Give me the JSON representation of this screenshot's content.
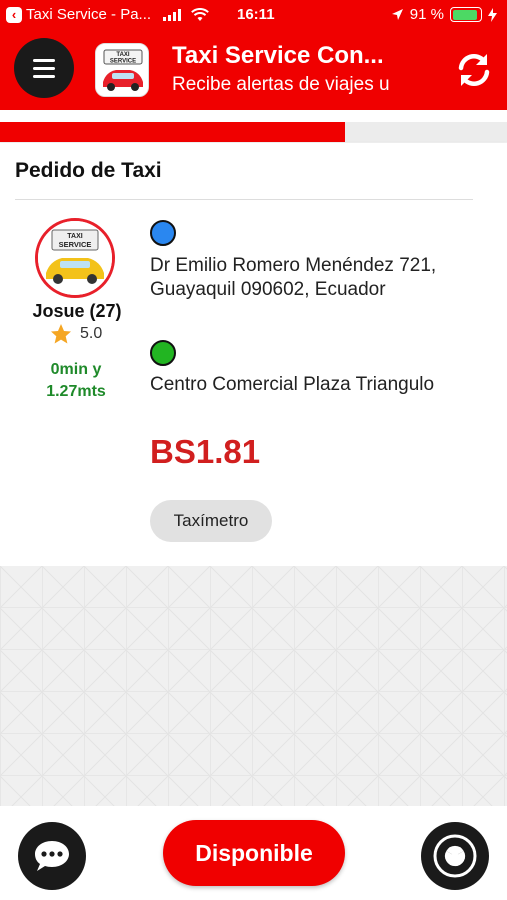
{
  "status_bar": {
    "back_app": "Taxi Service - Pa...",
    "time": "16:11",
    "battery": "91 %",
    "battery_level": 0.91
  },
  "header": {
    "title": "Taxi Service Con...",
    "subtitle": "Recibe alertas de viajes u",
    "logo_text_top": "TAXI",
    "logo_text_bottom": "SERVICE"
  },
  "progress": {
    "value": 0.68
  },
  "request": {
    "title": "Pedido de Taxi",
    "driver_name": "Josue (27)",
    "rating": "5.0",
    "eta_line1": "0min y",
    "eta_line2": "1.27mts",
    "origin": "Dr Emilio Romero Menéndez 721, Guayaquil 090602, Ecuador",
    "destination": "Centro Comercial Plaza Triangulo",
    "fare": "BS1.81",
    "taximetro_label": "Taxímetro"
  },
  "bottom": {
    "disponible_label": "Disponible"
  },
  "colors": {
    "brand_red": "#f00000",
    "fare_red": "#d11f1f",
    "eta_green": "#1f8a2a",
    "origin_blue": "#2a87f0",
    "dest_green": "#22b522"
  }
}
